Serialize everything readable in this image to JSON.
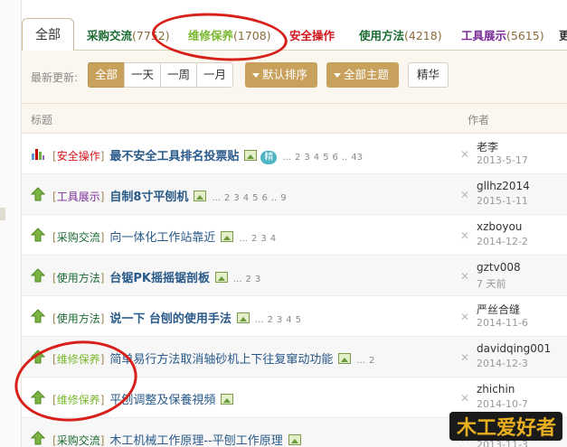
{
  "categories": [
    {
      "label": "全部",
      "count": "",
      "color": "#333333"
    },
    {
      "label": "采购交流",
      "count": "(7752)",
      "color": "#1a6b32"
    },
    {
      "label": "维修保养",
      "count": "(1708)",
      "color": "#7ab82e"
    },
    {
      "label": "安全操作",
      "count": "",
      "color": "#d0161b"
    },
    {
      "label": "使用方法",
      "count": "(4218)",
      "color": "#1a6b32"
    },
    {
      "label": "工具展示",
      "count": "(5615)",
      "color": "#7a2a96"
    },
    {
      "label": "更",
      "count": "",
      "color": "#333333"
    }
  ],
  "filter": {
    "label": "最新更新:",
    "time_options": [
      "全部",
      "一天",
      "一周",
      "一月"
    ],
    "active_time": "全部",
    "sort_label": "默认排序",
    "topic_label": "全部主题",
    "digest_label": "精华"
  },
  "table": {
    "title_header": "标题",
    "author_header": "作者"
  },
  "threads": [
    {
      "icon": "poll-icon",
      "tag": "安全操作",
      "tag_color": "#d0161b",
      "subject": "最不安全工具排名投票贴",
      "bold": true,
      "attach": true,
      "digest": "精",
      "pages": [
        "...",
        "2",
        "3",
        "4",
        "5",
        "6",
        "..",
        "43"
      ],
      "author": "老李",
      "date": "2013-5-17"
    },
    {
      "icon": "thread-up-icon",
      "tag": "工具展示",
      "tag_color": "#7a2a96",
      "subject": "自制8寸平刨机",
      "bold": true,
      "attach": true,
      "digest": "",
      "pages": [
        "...",
        "2",
        "3",
        "4",
        "5",
        "6",
        "..",
        "9"
      ],
      "author": "gllhz2014",
      "date": "2015-1-11"
    },
    {
      "icon": "thread-up-icon",
      "tag": "采购交流",
      "tag_color": "#1a6b32",
      "subject": "向一体化工作站靠近",
      "bold": false,
      "attach": true,
      "digest": "",
      "pages": [
        "...",
        "2",
        "3",
        "4"
      ],
      "author": "xzboyou",
      "date": "2014-12-2"
    },
    {
      "icon": "thread-up-icon",
      "tag": "使用方法",
      "tag_color": "#1a6b32",
      "subject": "台锯PK摇摇锯剖板",
      "bold": true,
      "attach": true,
      "digest": "",
      "pages": [
        "...",
        "2",
        "3"
      ],
      "author": "gztv008",
      "date": "7 天前"
    },
    {
      "icon": "thread-up-icon",
      "tag": "使用方法",
      "tag_color": "#1a6b32",
      "subject": "说一下 台刨的使用手法",
      "bold": true,
      "attach": true,
      "digest": "",
      "pages": [
        "...",
        "2",
        "3",
        "4",
        "5"
      ],
      "author": "严丝合缝",
      "date": "2014-11-6"
    },
    {
      "icon": "thread-up-icon",
      "tag": "维修保养",
      "tag_color": "#7ab82e",
      "subject": "简单易行方法取消轴砂机上下往复窜动功能",
      "bold": false,
      "attach": true,
      "digest": "",
      "pages": [
        "...",
        "2"
      ],
      "author": "davidqing001",
      "date": "2014-12-3"
    },
    {
      "icon": "thread-up-icon",
      "tag": "维修保养",
      "tag_color": "#7ab82e",
      "subject": "平刨调整及保養視頻",
      "bold": false,
      "attach": true,
      "digest": "",
      "pages": [],
      "author": "zhichin",
      "date": "2014-10-7"
    },
    {
      "icon": "thread-up-icon",
      "tag": "采购交流",
      "tag_color": "#1a6b32",
      "subject": "木工机械工作原理--平刨工作原理",
      "bold": false,
      "attach": true,
      "digest": "",
      "pages": [],
      "author": "",
      "date": "2013-11-3"
    }
  ],
  "watermark": "木工爱好者",
  "colors": {
    "accent": "#c8a25c",
    "annotation": "#d8201a",
    "link": "#2a5a8a"
  }
}
